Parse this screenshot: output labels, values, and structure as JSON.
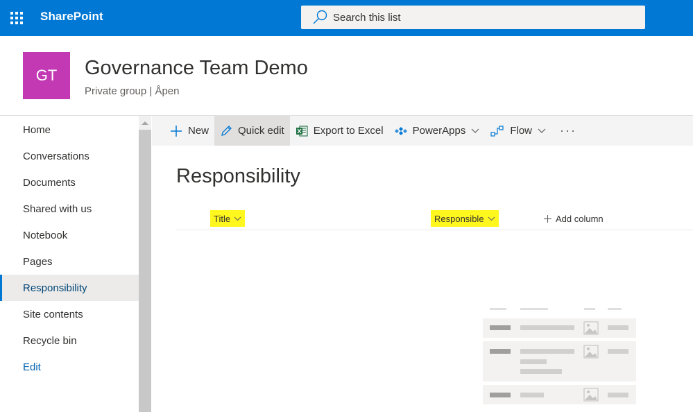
{
  "colors": {
    "brand": "#0078d4",
    "site_logo_bg": "#c239b3",
    "highlight": "#fff71e",
    "nav_selected_bg": "#edebe9"
  },
  "suite_bar": {
    "app_launcher_icon": "waffle-icon",
    "app_name": "SharePoint",
    "search": {
      "icon": "search-icon",
      "placeholder": "Search this list"
    }
  },
  "site": {
    "logo_initials": "GT",
    "title": "Governance Team Demo",
    "subtitle": "Private group | Åpen"
  },
  "left_nav": {
    "items": [
      {
        "label": "Home"
      },
      {
        "label": "Conversations"
      },
      {
        "label": "Documents"
      },
      {
        "label": "Shared with us"
      },
      {
        "label": "Notebook"
      },
      {
        "label": "Pages"
      },
      {
        "label": "Responsibility",
        "selected": true
      },
      {
        "label": "Site contents"
      },
      {
        "label": "Recycle bin"
      }
    ],
    "edit_label": "Edit"
  },
  "command_bar": {
    "new": {
      "label": "New",
      "icon": "plus-icon"
    },
    "quick_edit": {
      "label": "Quick edit",
      "icon": "pencil-icon"
    },
    "export": {
      "label": "Export to Excel",
      "icon": "excel-icon"
    },
    "powerapps": {
      "label": "PowerApps",
      "icon": "powerapps-icon"
    },
    "flow": {
      "label": "Flow",
      "icon": "flow-icon"
    },
    "more": {
      "label": "···",
      "icon": "more-icon"
    }
  },
  "list": {
    "title": "Responsibility",
    "columns": [
      {
        "label": "Title"
      },
      {
        "label": "Responsible"
      }
    ],
    "add_column_label": "Add column",
    "rows": []
  }
}
